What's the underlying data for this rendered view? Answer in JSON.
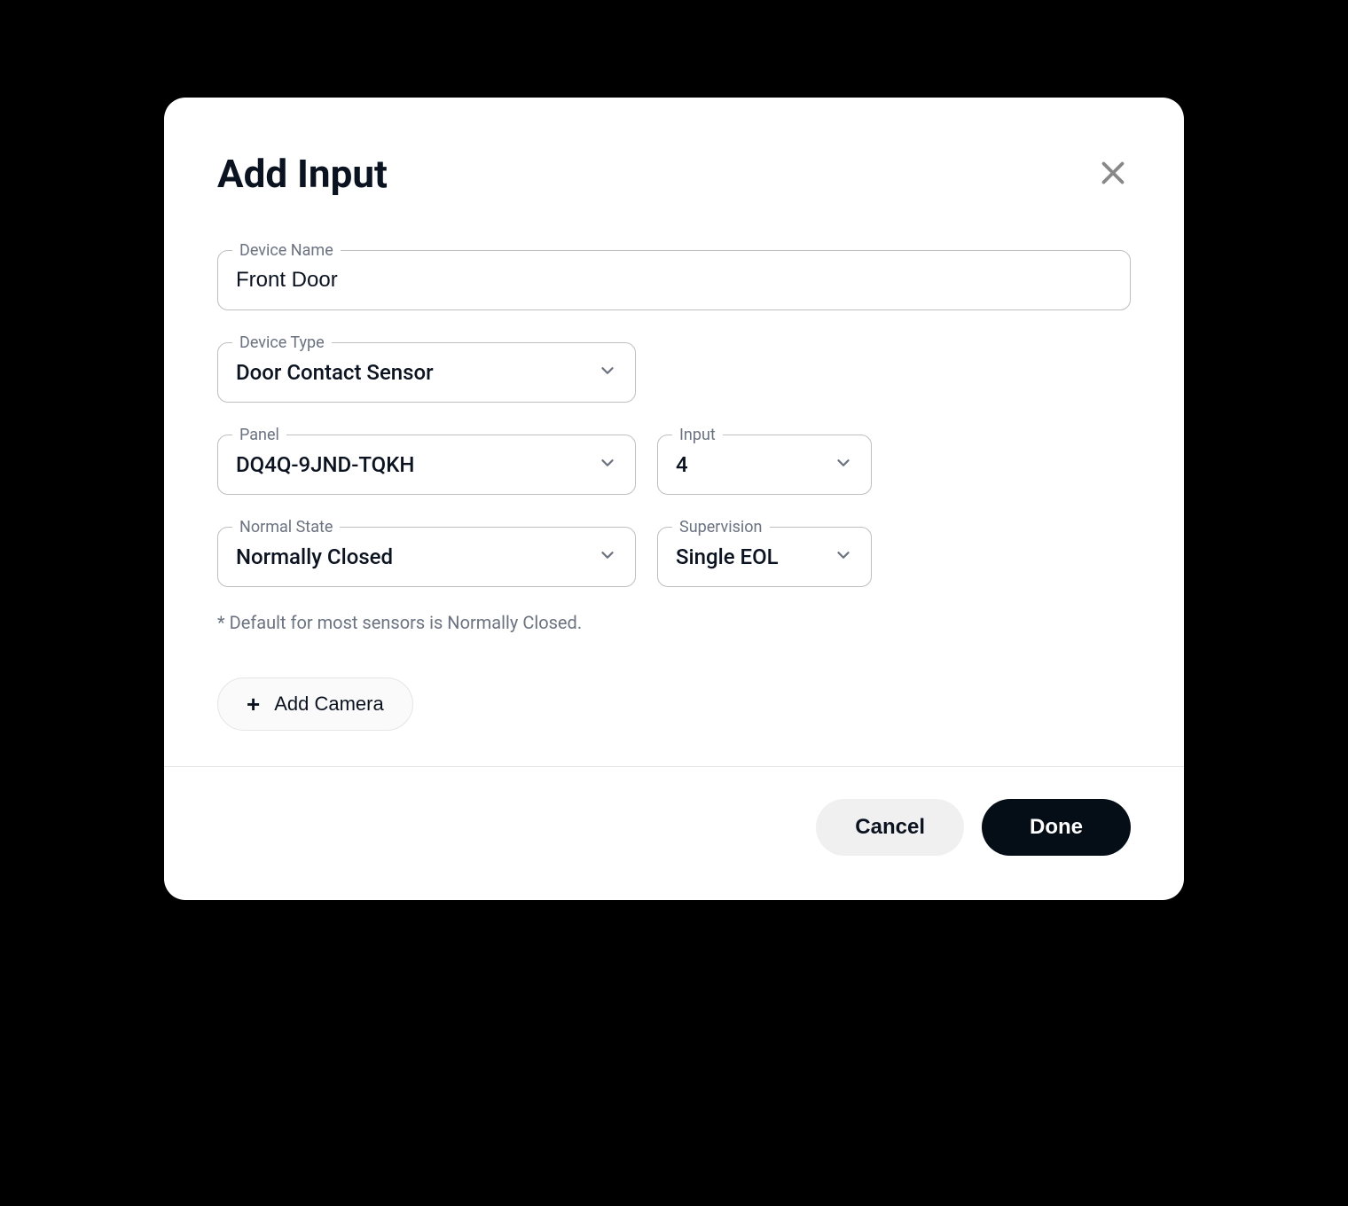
{
  "modal": {
    "title": "Add Input"
  },
  "fields": {
    "device_name": {
      "label": "Device Name",
      "value": "Front Door"
    },
    "device_type": {
      "label": "Device Type",
      "value": "Door Contact Sensor"
    },
    "panel": {
      "label": "Panel",
      "value": "DQ4Q-9JND-TQKH"
    },
    "input": {
      "label": "Input",
      "value": "4"
    },
    "normal_state": {
      "label": "Normal State",
      "value": "Normally Closed"
    },
    "supervision": {
      "label": "Supervision",
      "value": "Single EOL"
    }
  },
  "helper": "* Default for most sensors is Normally Closed.",
  "buttons": {
    "add_camera": "Add Camera",
    "cancel": "Cancel",
    "done": "Done"
  }
}
